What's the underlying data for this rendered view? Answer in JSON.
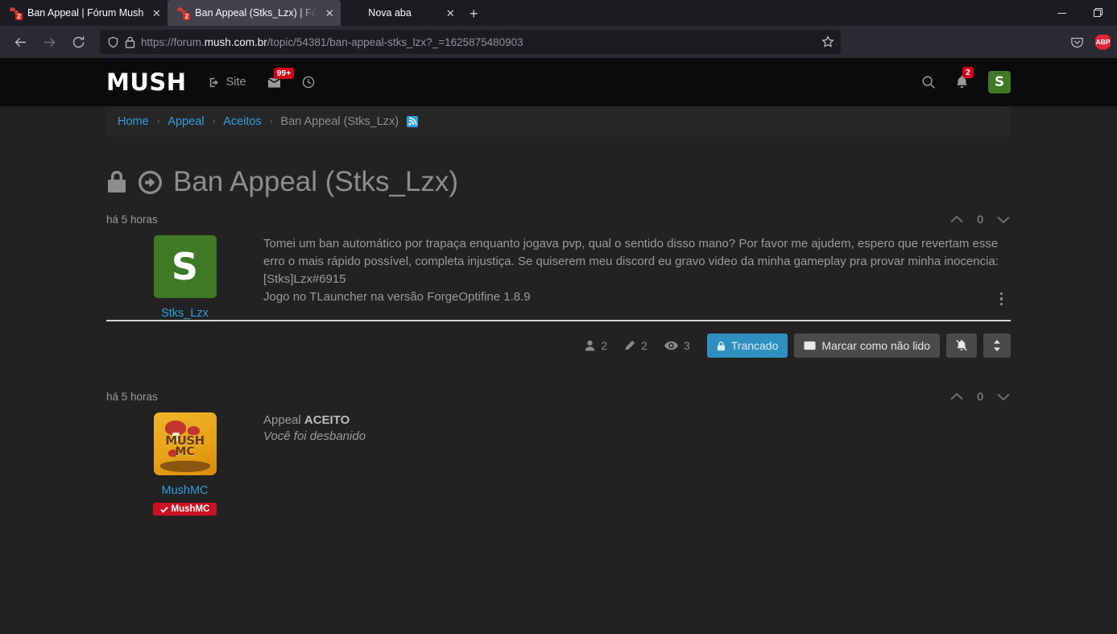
{
  "browser": {
    "tabs": [
      {
        "title": "Ban Appeal | Fórum Mush",
        "favicon": "mush-icon",
        "badge": "2",
        "active": false
      },
      {
        "title": "Ban Appeal (Stks_Lzx) | Fórum M",
        "favicon": "mush-icon",
        "badge": "2",
        "active": true
      },
      {
        "title": "Nova aba",
        "favicon": "firefox-icon",
        "badge": "",
        "active": false
      }
    ],
    "new_tab_label": "+",
    "close_label": "✕",
    "window_controls": {
      "minimize": "minimize-icon",
      "restore": "restore-icon"
    },
    "url": {
      "prefix": "https://forum.",
      "domain": "mush.com.br",
      "path": "/topic/54381/ban-appeal-stks_lzx?_=1625875480903"
    },
    "nav": {
      "back": "back-icon",
      "forward": "forward-icon",
      "reload": "reload-icon"
    },
    "extensions": {
      "pocket": "pocket-icon",
      "adblock": "ABP"
    }
  },
  "site_header": {
    "logo": "MUSH",
    "nav": [
      {
        "label": "Site",
        "icon": "external-link-icon",
        "badge": ""
      },
      {
        "label": "",
        "icon": "envelope-icon",
        "badge": "99+"
      },
      {
        "label": "",
        "icon": "clock-icon",
        "badge": ""
      }
    ],
    "search_icon": "search-icon",
    "notifications": {
      "icon": "bell-icon",
      "badge": "2"
    },
    "avatar_letter": "S"
  },
  "breadcrumb": {
    "items": [
      {
        "label": "Home",
        "link": true
      },
      {
        "label": "Appeal",
        "link": true
      },
      {
        "label": "Aceitos",
        "link": true
      },
      {
        "label": "Ban Appeal (Stks_Lzx)",
        "link": false
      }
    ],
    "separator": "›",
    "rss_icon": "rss-icon"
  },
  "page_title": {
    "text": "Ban Appeal (Stks_Lzx)",
    "lock_icon": "lock-icon",
    "moved_icon": "arrow-circle-right-icon"
  },
  "posts": [
    {
      "timestamp": "há 5 horas",
      "vote_count": "0",
      "upvote_icon": "chevron-up-icon",
      "downvote_icon": "chevron-down-icon",
      "author": "Stks_Lzx",
      "avatar_letter": "S",
      "avatar_color": "#3e7a25",
      "badge": "",
      "paragraphs": [
        "Tomei um ban automático por trapaça enquanto jogava pvp, qual o sentido disso mano? Por favor me ajudem, espero que revertam esse erro o mais rápido possível, completa injustiça. Se quiserem meu discord eu gravo video da minha gameplay pra provar minha inocencia: [Stks]Lzx#6915",
        "Jogo no TLauncher na versão ForgeOptifine 1.8.9"
      ],
      "menu_icon": "more-vertical-icon"
    },
    {
      "timestamp": "há 5 horas",
      "vote_count": "0",
      "upvote_icon": "chevron-up-icon",
      "downvote_icon": "chevron-down-icon",
      "author": "MushMC",
      "avatar_letter": "",
      "avatar_color": "#e8a317",
      "badge": "MushMC",
      "badge_icon": "check-icon",
      "line1_prefix": "Appeal ",
      "line1_strong": "ACEITO",
      "line2_italic": "Você foi desbanido"
    }
  ],
  "toolbar": {
    "stats": [
      {
        "icon": "user-icon",
        "value": "2"
      },
      {
        "icon": "pencil-icon",
        "value": "2"
      },
      {
        "icon": "eye-icon",
        "value": "3"
      }
    ],
    "locked_button": {
      "label": "Trancado",
      "icon": "lock-icon",
      "color": "#2f8fbf"
    },
    "unread_button": {
      "label": "Marcar como não lido",
      "icon": "envelope-icon"
    },
    "mute_button": {
      "icon": "bell-slash-icon"
    },
    "sort_button": {
      "icon": "sort-icon"
    }
  }
}
